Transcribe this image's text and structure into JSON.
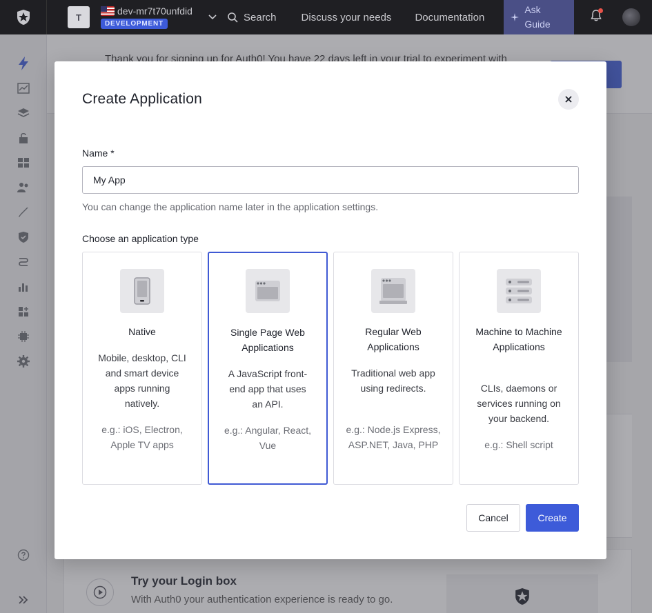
{
  "topbar": {
    "tenant_initial": "T",
    "tenant_name": "dev-mr7t70unfdid",
    "environment": "DEVELOPMENT",
    "search_label": "Search",
    "nav_links": [
      "Discuss your needs",
      "Documentation"
    ],
    "ask_guide_line1": "Ask",
    "ask_guide_line2": "Guide"
  },
  "background": {
    "banner_text": "Thank you for signing up for Auth0! You have 22 days left in your trial to experiment with",
    "login_title": "Try your Login box",
    "login_text": "With Auth0 your authentication experience is ready to go."
  },
  "modal": {
    "title": "Create Application",
    "name_label": "Name *",
    "name_value": "My App",
    "helper_text": "You can change the application name later in the application settings.",
    "type_label": "Choose an application type",
    "cards": [
      {
        "title": "Native",
        "desc": "Mobile, desktop, CLI and smart device apps running natively.",
        "example": "e.g.: iOS, Electron, Apple TV apps"
      },
      {
        "title": "Single Page Web Applications",
        "desc": "A JavaScript front-end app that uses an API.",
        "example": "e.g.: Angular, React, Vue"
      },
      {
        "title": "Regular Web Applications",
        "desc": "Traditional web app using redirects.",
        "example": "e.g.: Node.js Express, ASP.NET, Java, PHP"
      },
      {
        "title": "Machine to Machine Applications",
        "desc": "CLIs, daemons or services running on your backend.",
        "example": "e.g.: Shell script"
      }
    ],
    "cancel_label": "Cancel",
    "create_label": "Create"
  },
  "colors": {
    "accent": "#3d5bd9",
    "topbar": "#1f1f23",
    "selected_border": "#3f59d4"
  },
  "icons": [
    "auth0-logo-icon",
    "flag-icon",
    "chevron-down-icon",
    "search-icon",
    "sparkle-icon",
    "bell-icon",
    "close-icon",
    "mobile-device-icon",
    "browser-window-icon",
    "server-stack-icon",
    "play-icon",
    "help-icon",
    "expand-icon"
  ]
}
